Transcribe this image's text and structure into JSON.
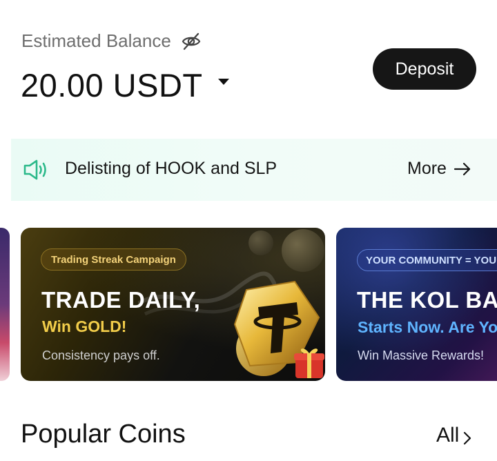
{
  "balance": {
    "label": "Estimated Balance",
    "value": "20.00 USDT",
    "hide_icon": "eye-slash-icon",
    "currency_icon": "caret-down-icon"
  },
  "deposit_label": "Deposit",
  "announcement": {
    "icon": "speaker-icon",
    "text": "Delisting of HOOK and SLP",
    "more_label": "More",
    "more_icon": "arrow-right-icon"
  },
  "banners": [
    {
      "tag": "Trading Streak Campaign",
      "headline": "TRADE DAILY,",
      "subheadline": "Win GOLD!",
      "description": "Consistency pays off."
    },
    {
      "tag": "YOUR COMMUNITY = YOUR",
      "headline": "THE KOL BAT",
      "subheadline": "Starts Now. Are Yo",
      "description": "Win Massive Rewards!"
    }
  ],
  "popular": {
    "title": "Popular Coins",
    "all_label": "All"
  },
  "colors": {
    "accent_green": "#2bb98a",
    "button_dark": "#161616",
    "gold": "#f2cd4a",
    "kol_blue": "#5fb4ff"
  }
}
